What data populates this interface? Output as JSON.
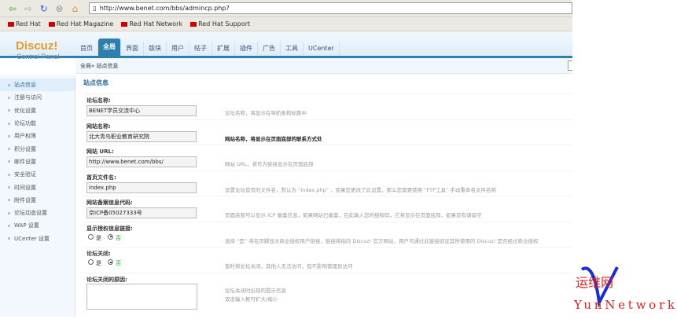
{
  "browser": {
    "url": "http://www.benet.com/bbs/admincp.php?",
    "bookmarks": [
      "Red Hat",
      "Red Hat Magazine",
      "Red Hat Network",
      "Red Hat Support"
    ]
  },
  "logo": {
    "title": "Discuz!",
    "subtitle": "Control Panel"
  },
  "nav": {
    "tabs": [
      "首页",
      "全局",
      "界面",
      "版块",
      "用户",
      "帖子",
      "扩展",
      "插件",
      "广告",
      "工具",
      "UCenter"
    ],
    "active": 1
  },
  "breadcrumb": "全局» 站点信息",
  "sidebar": {
    "items": [
      "站点信息",
      "注册与访问",
      "优化设置",
      "论坛功能",
      "用户权限",
      "积分设置",
      "邮件设置",
      "安全验证",
      "时间设置",
      "附件设置",
      "论坛动态设置",
      "WAP 设置",
      "UCenter 设置"
    ]
  },
  "main": {
    "title": "站点信息",
    "fields": [
      {
        "label": "论坛名称:",
        "value": "BENET学员交流中心",
        "tip": "论坛名称，将显示在导航条和标题中"
      },
      {
        "label": "网站名称:",
        "value": "北大青鸟职业教育研究院",
        "tip": "网站名称，将显示在页面底部的联系方式处"
      },
      {
        "label": "网站 URL:",
        "value": "http://www.benet.com/bbs/",
        "tip": "网站 URL，将作为链接显示在页面底部"
      },
      {
        "label": "首页文件名:",
        "value": "index.php",
        "tip": "设置论坛首页的文件名，默认为 “index.php” ，如果您更改了此设置，那么您需要使用 “FTP工具” 手动重命名文件名称"
      },
      {
        "label": "网站备案信息代码:",
        "value": "京ICP备05027333号",
        "tip": "页面底部可以显示 ICP 备案信息，如果网站已备案，在此输入您的授权码，它将显示在页面底部，如果没有请留空"
      }
    ],
    "radios": [
      {
        "label": "显示授权信息链接:",
        "yes": "是",
        "no": "否",
        "selected": "no",
        "tip": "选择 “是” 将在页脚显示商业授权用户链接，链接将指向 Discuz! 官方网站，用户可通过此链接验证其所使用的 Discuz! 是否经过商业授权"
      },
      {
        "label": "论坛关闭:",
        "yes": "是",
        "no": "否",
        "selected": "no",
        "tip": "暂时将论坛关闭，其他人无法访问，但不影响管理员访问"
      }
    ],
    "close_reason": {
      "label": "论坛关闭的原因:",
      "tip1": "论坛关闭时出现的提示信息",
      "tip2": "双击输入框可扩大/缩小"
    }
  },
  "watermark": {
    "cn": "运维网",
    "en": "YunNetwork"
  }
}
